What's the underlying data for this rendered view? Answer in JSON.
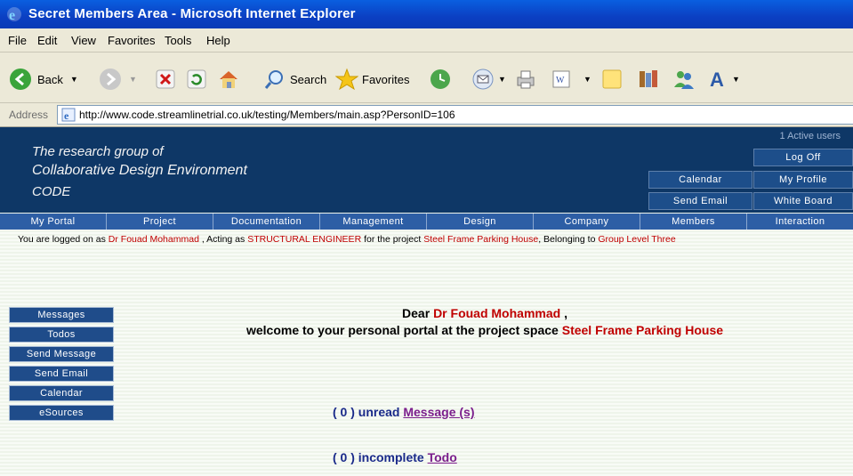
{
  "window": {
    "title": "Secret Members Area - Microsoft Internet Explorer"
  },
  "menu": [
    "File",
    "Edit",
    "View",
    "Favorites",
    "Tools",
    "Help"
  ],
  "toolbar": {
    "back": "Back",
    "search": "Search",
    "favorites": "Favorites"
  },
  "address": {
    "label": "Address",
    "url": "http://www.code.streamlinetrial.co.uk/testing/Members/main.asp?PersonID=106"
  },
  "header": {
    "line1": "The research group of",
    "line2": "Collaborative Design Environment",
    "line3": "CODE",
    "active_users": "1 Active users",
    "buttons": {
      "logoff": "Log Off",
      "calendar": "Calendar",
      "profile": "My Profile",
      "email": "Send Email",
      "whiteboard": "White Board"
    }
  },
  "nav": [
    "My Portal",
    "Project",
    "Documentation",
    "Management",
    "Design",
    "Company",
    "Members",
    "Interaction"
  ],
  "status": {
    "p1": "You are logged on as ",
    "name": "Dr Fouad Mohammad",
    "p2": " , Acting as ",
    "role": "STRUCTURAL ENGINEER",
    "p3": " for the project ",
    "project": "Steel Frame Parking House",
    "p4": ", Belonging to ",
    "group": "Group Level Three"
  },
  "sidebar": [
    "Messages",
    "Todos",
    "Send Message",
    "Send Email",
    "Calendar",
    "eSources"
  ],
  "welcome": {
    "dear": "Dear ",
    "name": "Dr Fouad  Mohammad",
    "comma": " ,",
    "line2": "welcome to your personal portal at the project space ",
    "project": "Steel Frame Parking House"
  },
  "messages": {
    "count": "( 0 ) unread ",
    "link": "Message (s)"
  },
  "todos": {
    "count": "( 0 ) incomplete ",
    "link": "Todo"
  },
  "colors": {
    "header_bg": "#0e3766",
    "nav_bg": "#2d5ea5",
    "accent_red": "#c00000",
    "link_purple": "#7b1e8c"
  }
}
